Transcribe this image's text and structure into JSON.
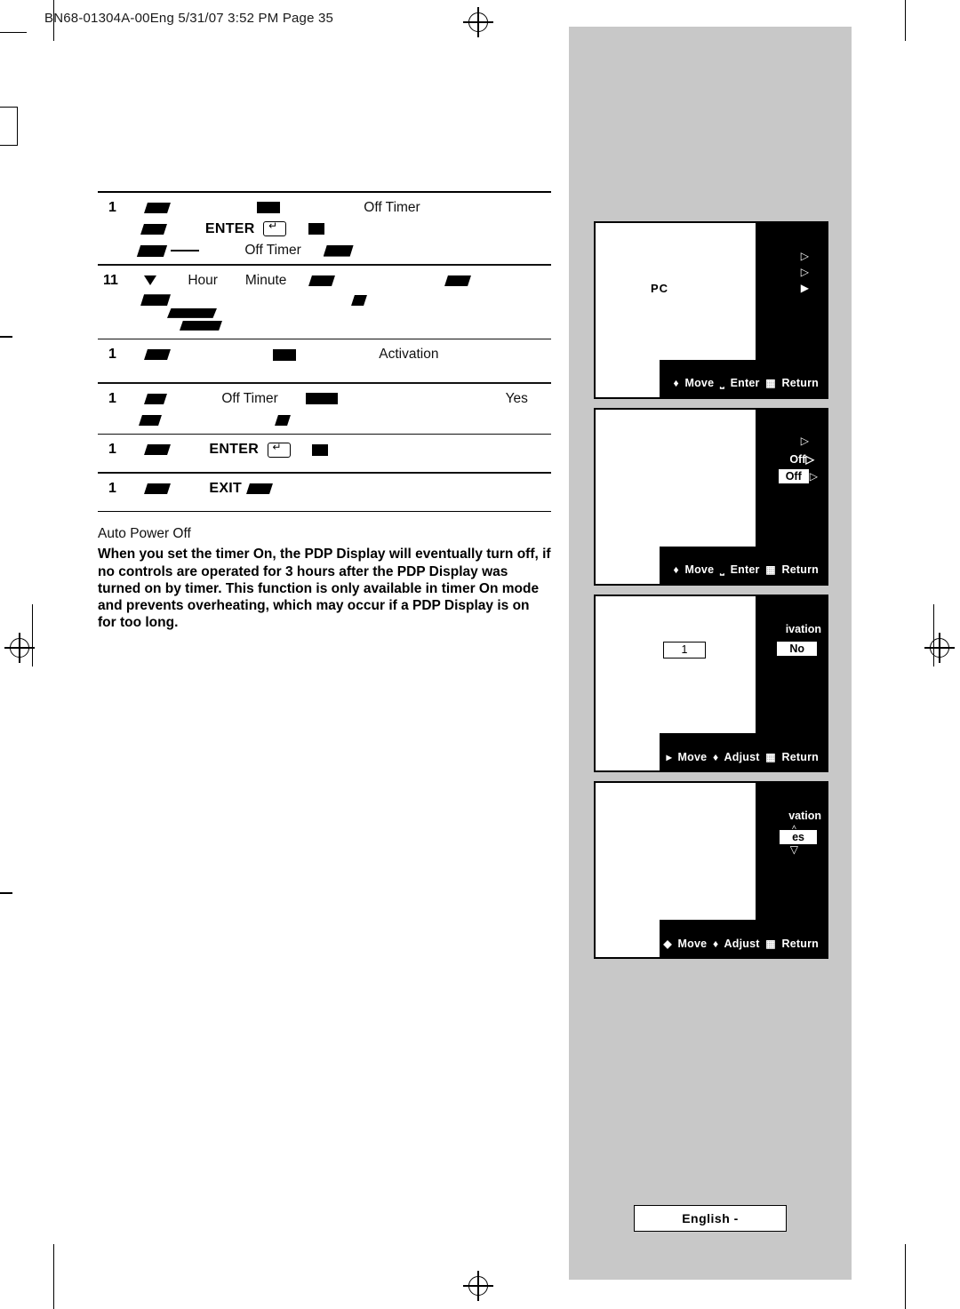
{
  "header": {
    "line": "BN68-01304A-00Eng  5/31/07  3:52 PM  Page 35"
  },
  "steps": [
    {
      "num": "1",
      "text1": "Off Timer",
      "enter": "ENTER"
    },
    {
      "num": "",
      "text1": "Off Timer"
    },
    {
      "num": "11",
      "labels": [
        "Hour",
        "Minute"
      ]
    },
    {
      "num": "1",
      "text1": "Activation"
    },
    {
      "num": "1",
      "text1": "Off Timer",
      "text2": "Yes"
    },
    {
      "num": "1",
      "label": "ENTER"
    },
    {
      "num": "1",
      "label": "EXIT"
    }
  ],
  "note": {
    "title": "Auto Power Off",
    "body": "When you set the timer On, the PDP Display will eventually turn off, if no controls are operated for 3 hours after the PDP Display was turned on by timer. This function is only available in timer On mode and prevents overheating, which may occur if a PDP Display is on for too long."
  },
  "osd": [
    {
      "id": "osd-1",
      "pc_label": "PC",
      "foot": {
        "move": "Move",
        "enter": "Enter",
        "return": "Return"
      }
    },
    {
      "id": "osd-2",
      "value_top": "Off",
      "value_selected": "Off",
      "foot": {
        "move": "Move",
        "enter": "Enter",
        "return": "Return"
      }
    },
    {
      "id": "osd-3",
      "activation": "ivation",
      "number": "1",
      "value_selected": "No",
      "foot": {
        "move": "Move",
        "adjust": "Adjust",
        "return": "Return"
      }
    },
    {
      "id": "osd-4",
      "activation": "vation",
      "value_selected": "es",
      "foot": {
        "move": "Move",
        "adjust": "Adjust",
        "return": "Return"
      }
    }
  ],
  "footer": {
    "language": "English -"
  }
}
